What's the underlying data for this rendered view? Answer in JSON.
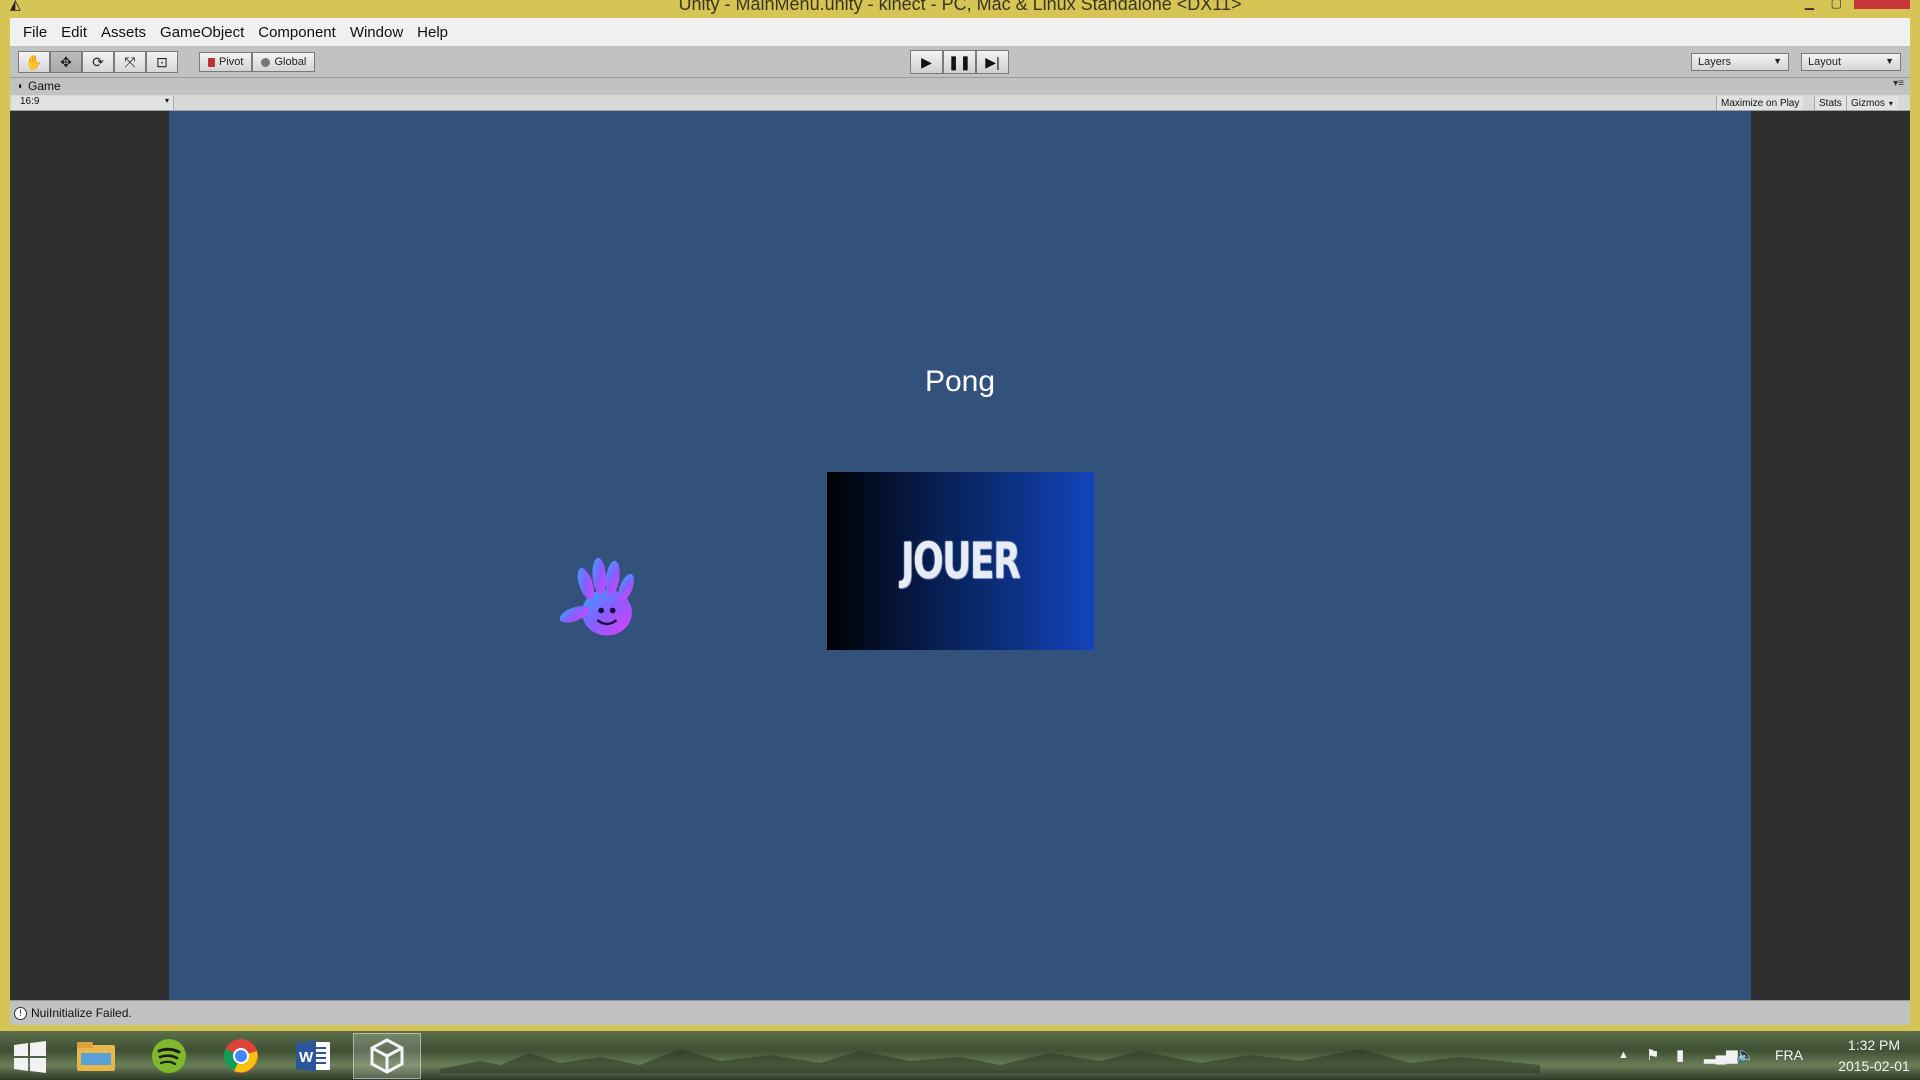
{
  "window": {
    "title": "Unity - MainMenu.unity - kinect - PC, Mac & Linux Standalone <DX11>",
    "close_color": "#c8363a",
    "frame_color": "#d6c454"
  },
  "menubar": {
    "items": [
      "File",
      "Edit",
      "Assets",
      "GameObject",
      "Component",
      "Window",
      "Help"
    ]
  },
  "toolbar": {
    "transform_tools": [
      "hand-icon",
      "move-icon",
      "rotate-icon",
      "scale-icon",
      "rect-icon"
    ],
    "pivot_label": "Pivot",
    "global_label": "Global",
    "layers_label": "Layers",
    "layout_label": "Layout"
  },
  "game_panel": {
    "tab_label": "Game",
    "aspect": "16:9",
    "maximize_label": "Maximize on Play",
    "stats_label": "Stats",
    "gizmos_label": "Gizmos"
  },
  "game_view": {
    "background_color": "#32527b",
    "title": "Pong",
    "play_button_label": "JOUER"
  },
  "status": {
    "message": "NuiInitialize Failed."
  },
  "taskbar": {
    "apps": [
      "file-explorer-icon",
      "spotify-icon",
      "chrome-icon",
      "word-icon",
      "unity-icon"
    ],
    "language": "FRA",
    "time": "1:32 PM",
    "date": "2015-02-01"
  }
}
